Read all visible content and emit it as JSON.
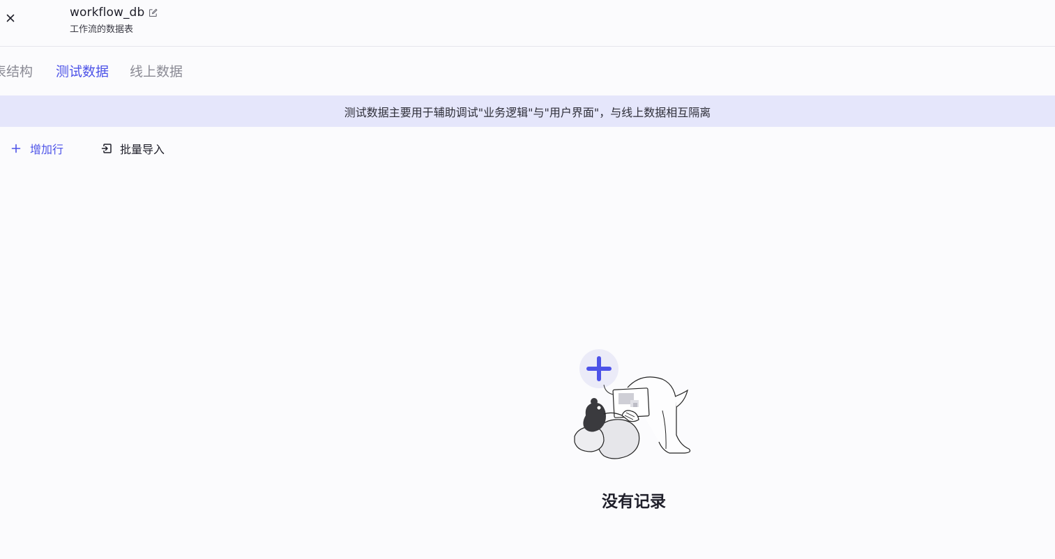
{
  "header": {
    "db_name": "workflow_db",
    "db_description": "工作流的数据表"
  },
  "tabs": [
    {
      "label": "表结构",
      "active": false
    },
    {
      "label": "测试数据",
      "active": true
    },
    {
      "label": "线上数据",
      "active": false
    }
  ],
  "banner": {
    "text": "测试数据主要用于辅助调试\"业务逻辑\"与\"用户界面\"，与线上数据相互隔离"
  },
  "toolbar": {
    "add_row_label": "增加行",
    "import_label": "批量导入"
  },
  "empty_state": {
    "text": "没有记录"
  },
  "colors": {
    "accent": "#4d53e8",
    "banner_bg": "#e5e6fb",
    "page_bg": "#fbfbfd"
  },
  "icons": [
    "close-icon",
    "edit-icon",
    "plus-icon",
    "import-icon",
    "empty-illustration"
  ]
}
